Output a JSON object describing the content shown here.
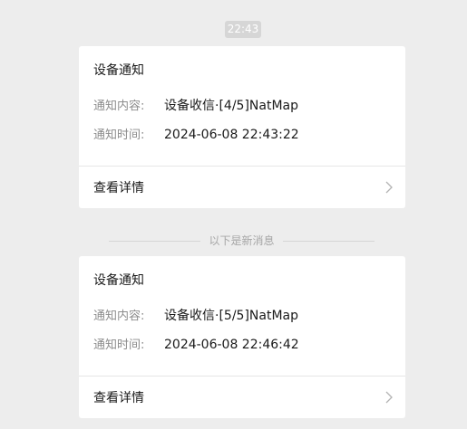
{
  "header": {
    "timestamp": "22:43"
  },
  "messages": [
    {
      "title": "设备通知",
      "content_label": "通知内容:",
      "content_value": "设备收信·[4/5]NatMap",
      "time_label": "通知时间:",
      "time_value": "2024-06-08 22:43:22",
      "details_label": "查看详情"
    },
    {
      "title": "设备通知",
      "content_label": "通知内容:",
      "content_value": "设备收信·[5/5]NatMap",
      "time_label": "通知时间:",
      "time_value": "2024-06-08 22:46:42",
      "details_label": "查看详情"
    }
  ],
  "separator": {
    "label": "以下是新消息"
  },
  "icons": {
    "details_chevron": "chevron-right-icon"
  },
  "colors": {
    "background": "#ededed",
    "card": "#ffffff",
    "label_gray": "#8c8c8c",
    "text_dark": "#1a1a1a"
  }
}
